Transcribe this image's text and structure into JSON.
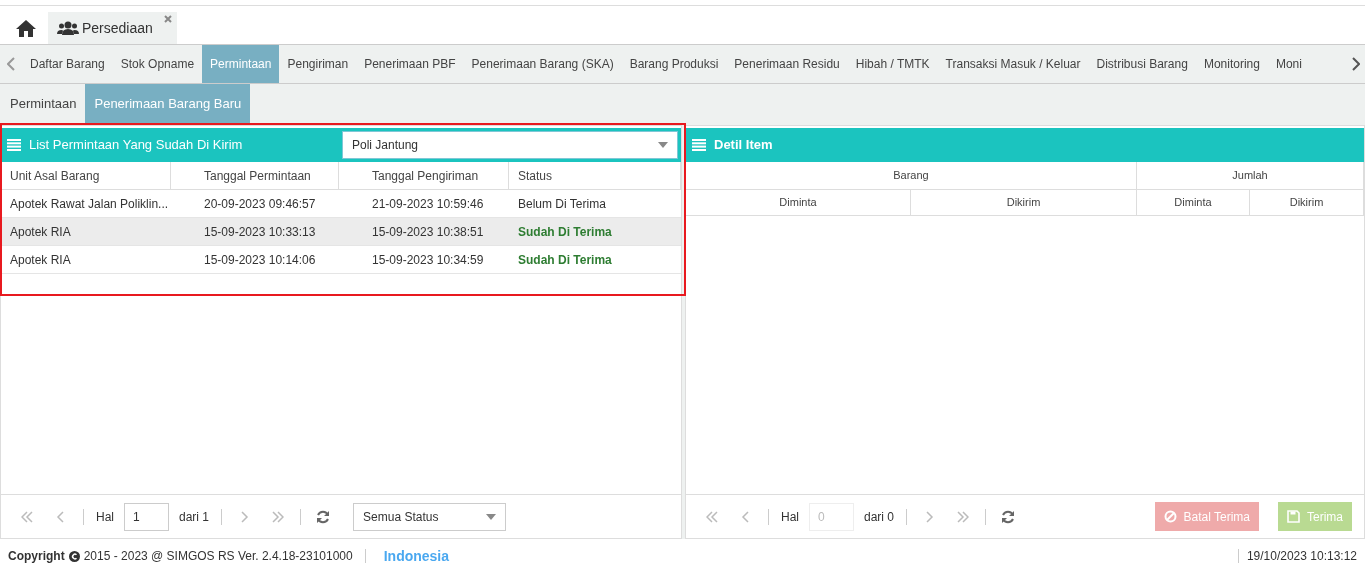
{
  "app_tabs": [
    {
      "label": "Persediaan",
      "closable": true,
      "selected": true
    }
  ],
  "menu_tabs": [
    {
      "label": "Daftar Barang",
      "selected": false
    },
    {
      "label": "Stok Opname",
      "selected": false
    },
    {
      "label": "Permintaan",
      "selected": true
    },
    {
      "label": "Pengiriman",
      "selected": false
    },
    {
      "label": "Penerimaan PBF",
      "selected": false
    },
    {
      "label": "Penerimaan Barang (SKA)",
      "selected": false
    },
    {
      "label": "Barang Produksi",
      "selected": false
    },
    {
      "label": "Penerimaan Residu",
      "selected": false
    },
    {
      "label": "Hibah / TMTK",
      "selected": false
    },
    {
      "label": "Transaksi Masuk / Keluar",
      "selected": false
    },
    {
      "label": "Distribusi Barang",
      "selected": false
    },
    {
      "label": "Monitoring",
      "selected": false
    },
    {
      "label": "Moni",
      "selected": false
    }
  ],
  "sub_tabs": [
    {
      "label": "Permintaan",
      "selected": false
    },
    {
      "label": "Penerimaan Barang Baru",
      "selected": true
    }
  ],
  "list_panel": {
    "title": "List Permintaan Yang Sudah Di Kirim",
    "unit_select": "Poli Jantung",
    "columns": [
      "Unit Asal Barang",
      "Tanggal Permintaan",
      "Tanggal Pengiriman",
      "Status"
    ],
    "rows": [
      {
        "unit": "Apotek Rawat Jalan Poliklin...",
        "tanggal_permintaan": "20-09-2023 09:46:57",
        "tanggal_pengiriman": "21-09-2023 10:59:46",
        "status": "Belum Di Terima",
        "received": false,
        "selected": false
      },
      {
        "unit": "Apotek RIA",
        "tanggal_permintaan": "15-09-2023 10:33:13",
        "tanggal_pengiriman": "15-09-2023 10:38:51",
        "status": "Sudah Di Terima",
        "received": true,
        "selected": true
      },
      {
        "unit": "Apotek RIA",
        "tanggal_permintaan": "15-09-2023 10:14:06",
        "tanggal_pengiriman": "15-09-2023 10:34:59",
        "status": "Sudah Di Terima",
        "received": true,
        "selected": false
      }
    ],
    "pager": {
      "label": "Hal",
      "page": "1",
      "of": "dari 1"
    },
    "status_filter": "Semua Status"
  },
  "detail_panel": {
    "title": "Detil Item",
    "group_columns": [
      "Barang",
      "Jumlah"
    ],
    "columns": [
      "Diminta",
      "Dikirim",
      "Diminta",
      "Dikirim"
    ],
    "pager": {
      "label": "Hal",
      "page": "0",
      "of": "dari 0",
      "disabled": true
    },
    "buttons": [
      {
        "label": "Batal Terima",
        "kind": "cancel",
        "disabled": true
      },
      {
        "label": "Terima",
        "kind": "save",
        "disabled": true
      }
    ]
  },
  "footer": {
    "copyright_label": "Copyright",
    "copyright": "2015 - 2023 @ SIMGOS RS Ver. 2.4.18-23101000",
    "language": "Indonesia",
    "datetime": "19/10/2023 10:13:12"
  }
}
